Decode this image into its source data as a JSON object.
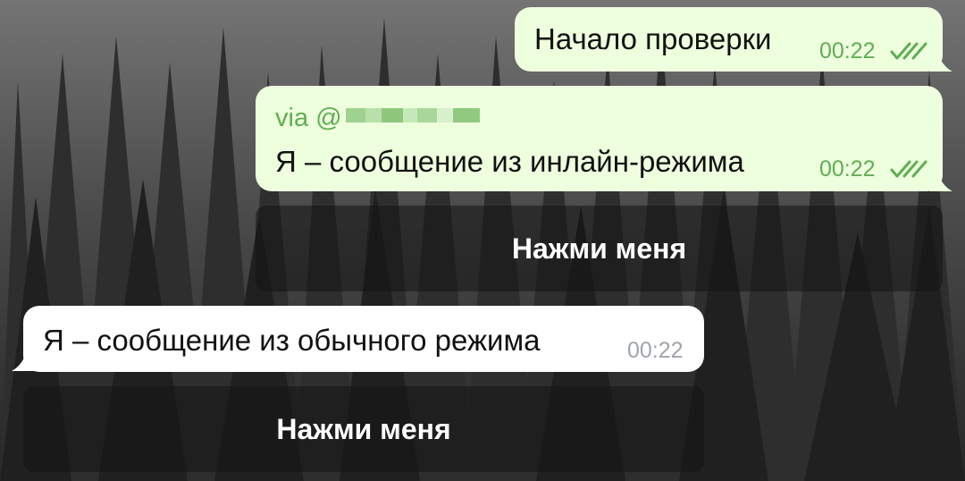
{
  "messages": {
    "m1": {
      "text": "Начало проверки",
      "time": "00:22",
      "status_icon": "double-check-icon"
    },
    "m2": {
      "via": "via @",
      "text": "Я – сообщение из инлайн-режима",
      "time": "00:22",
      "status_icon": "double-check-icon",
      "button_label": "Нажми меня"
    },
    "m3": {
      "text": "Я – сообщение из обычного режима",
      "time": "00:22",
      "button_label": "Нажми меня"
    }
  },
  "colors": {
    "outgoing_bubble": "#eeffde",
    "incoming_bubble": "#ffffff",
    "accent_green": "#5fae52",
    "inline_button_bg": "rgba(20,20,20,0.55)"
  }
}
